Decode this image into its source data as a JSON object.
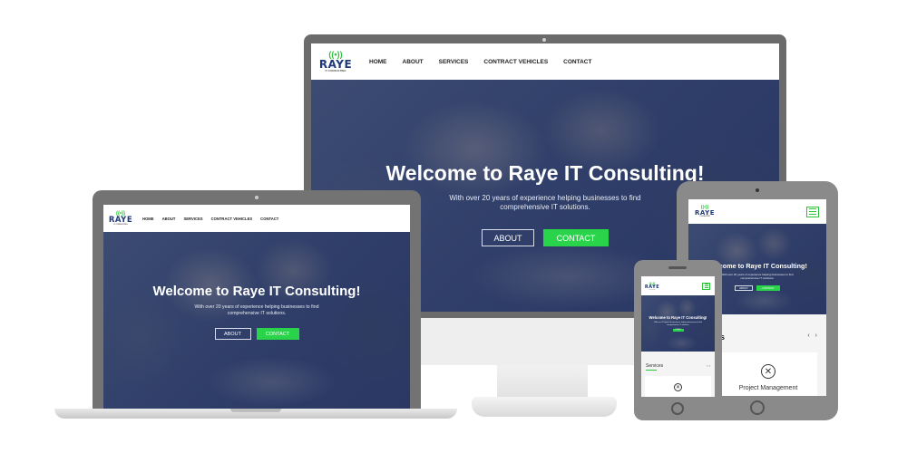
{
  "brand": {
    "logo_text": "RAYE",
    "logo_subtext": "IT CONSULTING",
    "wifi_glyph": "((•))",
    "accent_color": "#2ad44a",
    "brand_color": "#1f3a7a"
  },
  "nav": {
    "items": [
      "HOME",
      "ABOUT",
      "SERVICES",
      "CONTRACT VEHICLES",
      "CONTACT"
    ]
  },
  "hero": {
    "title": "Welcome to Raye IT Consulting!",
    "subtitle_line1": "With over 20 years of experience helping businesses to find",
    "subtitle_line2": "comprehensive IT solutions.",
    "about_button": "ABOUT",
    "contact_button": "CONTACT"
  },
  "services": {
    "title": "Services",
    "tablet_title_fragment": "es",
    "tablet_arrows": "‹ ›",
    "phone_arrows": "‹ ›",
    "card_title": "Project Management",
    "card_icon": "tools-icon",
    "card_icon_glyph": "✕"
  }
}
